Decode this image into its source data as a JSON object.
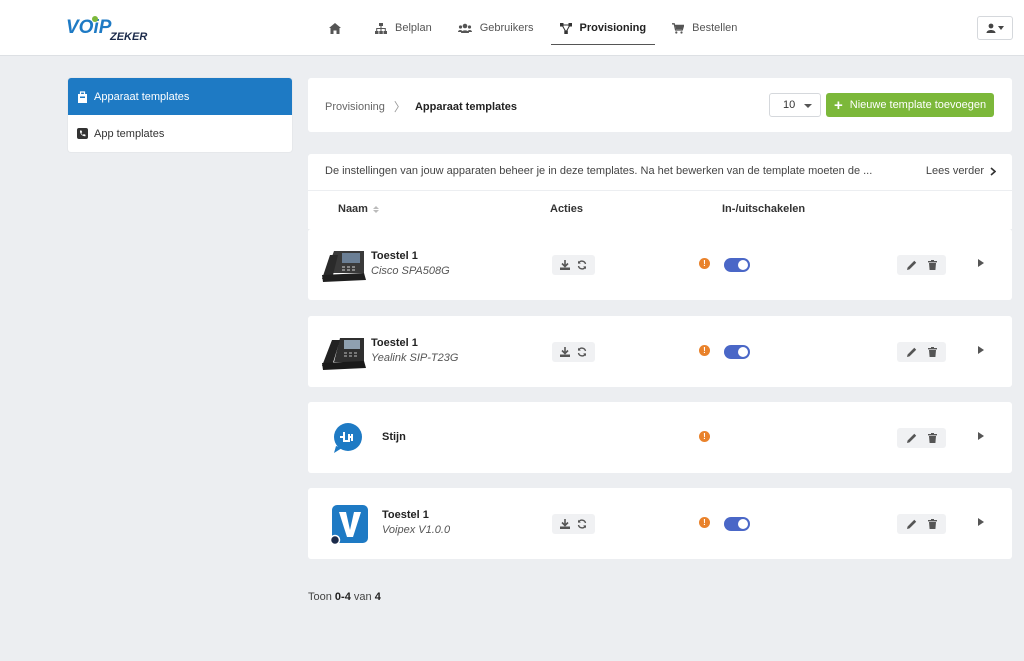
{
  "brand": {
    "logo_main": "VOiP",
    "logo_sub": "ZEKER",
    "accent": "#1e7ac4",
    "green": "#7cb83a"
  },
  "nav": {
    "items": [
      {
        "label": "",
        "icon": "home-icon"
      },
      {
        "label": "Belplan",
        "icon": "sitemap-icon"
      },
      {
        "label": "Gebruikers",
        "icon": "users-icon"
      },
      {
        "label": "Provisioning",
        "icon": "network-icon",
        "active": true
      },
      {
        "label": "Bestellen",
        "icon": "cart-icon"
      }
    ]
  },
  "sidebar": {
    "items": [
      {
        "label": "Apparaat templates",
        "icon": "device-icon",
        "active": true
      },
      {
        "label": "App templates",
        "icon": "phone-icon"
      }
    ]
  },
  "breadcrumb": {
    "parent": "Provisioning",
    "separator": "〉",
    "current": "Apparaat templates"
  },
  "toolbar": {
    "per_page": "10",
    "add_label": "Nieuwe template toevoegen"
  },
  "intro": {
    "text": "De instellingen van jouw apparaten beheer je in deze templates. Na het bewerken van de template moeten de ...",
    "more": "Lees verder"
  },
  "table": {
    "headers": {
      "name": "Naam",
      "actions": "Acties",
      "toggle": "In-/uitschakelen"
    },
    "rows": [
      {
        "name": "Toestel 1",
        "model": "Cisco SPA508G",
        "thumb": "cisco-phone",
        "actions": true,
        "enabled": true
      },
      {
        "name": "Toestel 1",
        "model": "Yealink SIP-T23G",
        "thumb": "yealink-phone",
        "actions": true,
        "enabled": true
      },
      {
        "name": "Stijn",
        "model": "",
        "thumb": "app-bubble",
        "actions": false,
        "enabled": null
      },
      {
        "name": "Toestel 1",
        "model": "Voipex V1.0.0",
        "thumb": "voipex-app",
        "actions": true,
        "enabled": true
      }
    ]
  },
  "footer": {
    "prefix": "Toon",
    "range": "0-4",
    "mid": "van",
    "total": "4"
  }
}
